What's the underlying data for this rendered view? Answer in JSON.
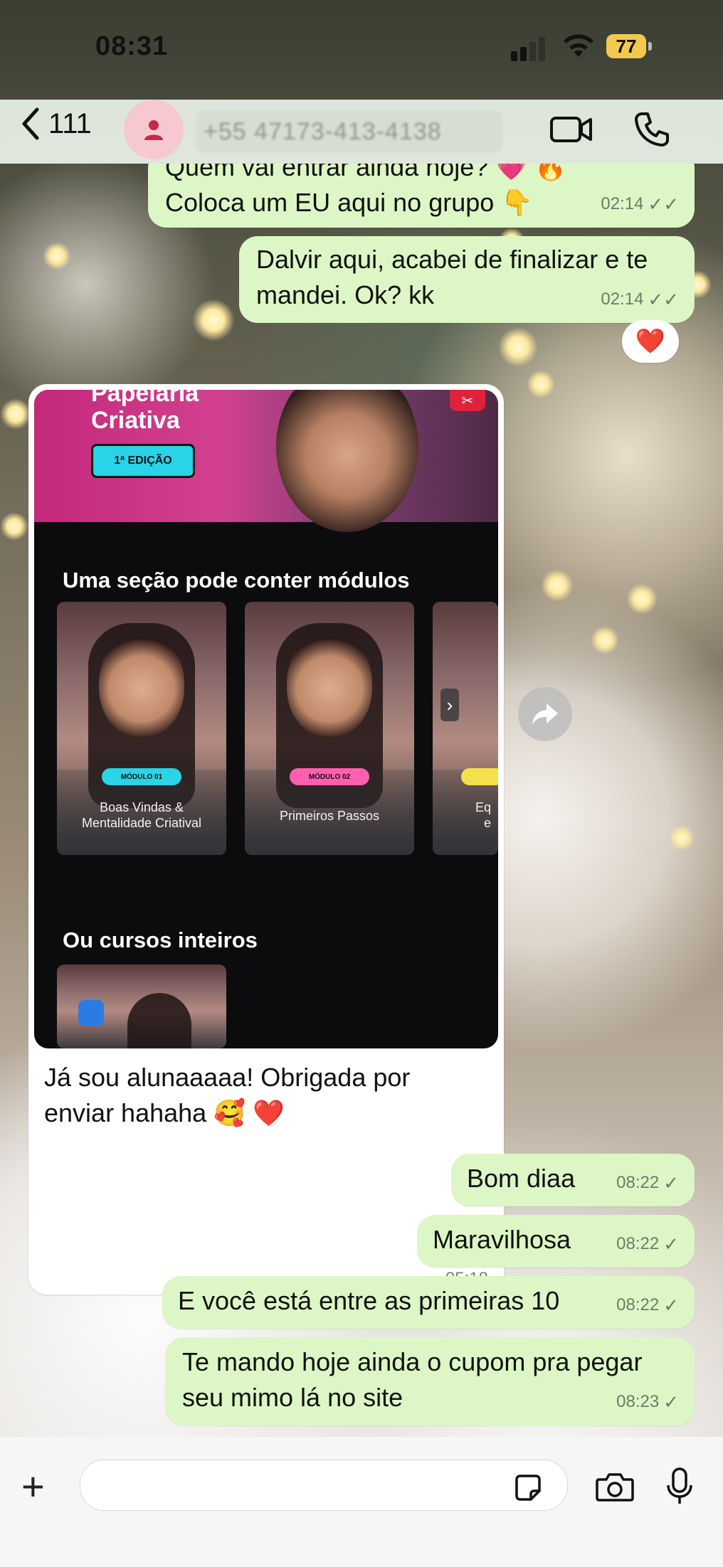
{
  "status_bar": {
    "time": "08:31",
    "battery": "77"
  },
  "header": {
    "back_count": "111",
    "contact_name": "+55 47173-413-4138",
    "icons": [
      "back-chevron-icon",
      "person-icon",
      "video-call-icon",
      "phone-icon"
    ]
  },
  "messages": [
    {
      "dir": "out",
      "text_line1": "Quem vai entrar ainda hoje? 💗 🔥",
      "text_line2": "Coloca um EU aqui no grupo 👇",
      "time": "02:14",
      "status": "read"
    },
    {
      "dir": "out",
      "text_line1": "Dalvir aqui, acabei de finalizar e te",
      "text_line2": "mandei. Ok? kk",
      "time": "02:14",
      "status": "read",
      "reaction": "❤️"
    },
    {
      "dir": "in",
      "type": "image",
      "caption_line1": "Já sou alunaaaaa! Obrigada por",
      "caption_line2": "enviar hahaha 🥰 ❤️",
      "time": "05:18",
      "image": {
        "banner_title_line1": "Papelaria",
        "banner_title_line2": "Criativa",
        "edition": "1ª EDIÇÃO",
        "section_title": "Uma seção pode conter módulos",
        "modules": [
          {
            "badge": "MÓDULO 01",
            "title_line1": "Boas Vindas &",
            "title_line2": "Mentalidade Criatival",
            "badge_color": "#29d3e8"
          },
          {
            "badge": "MÓDULO 02",
            "title_line1": "Primeiros Passos",
            "title_line2": "",
            "badge_color": "#ff5fb0"
          },
          {
            "badge": "",
            "title_line1": "Eq",
            "title_line2": "e",
            "badge_color": "#f5e04a"
          }
        ],
        "courses_title": "Ou cursos inteiros"
      }
    },
    {
      "dir": "out",
      "text_line1": "Bom diaa",
      "time": "08:22",
      "status": "sent"
    },
    {
      "dir": "out",
      "text_line1": "Maravilhosa",
      "time": "08:22",
      "status": "sent"
    },
    {
      "dir": "out",
      "text_line1": "E você está entre as primeiras 10",
      "time": "08:22",
      "status": "sent"
    },
    {
      "dir": "out",
      "text_line1": "Te mando hoje ainda o cupom pra pegar",
      "text_line2": "seu mimo lá no site",
      "time": "08:23",
      "status": "sent"
    }
  ],
  "composer": {
    "input_value": "",
    "icons": [
      "plus-icon",
      "sticker-icon",
      "camera-icon",
      "microphone-icon"
    ]
  },
  "colors": {
    "outgoing_bubble": "#dcf7c5",
    "incoming_bubble": "#ffffff",
    "header_bg": "#ecf3e8",
    "battery": "#f2c94c"
  }
}
